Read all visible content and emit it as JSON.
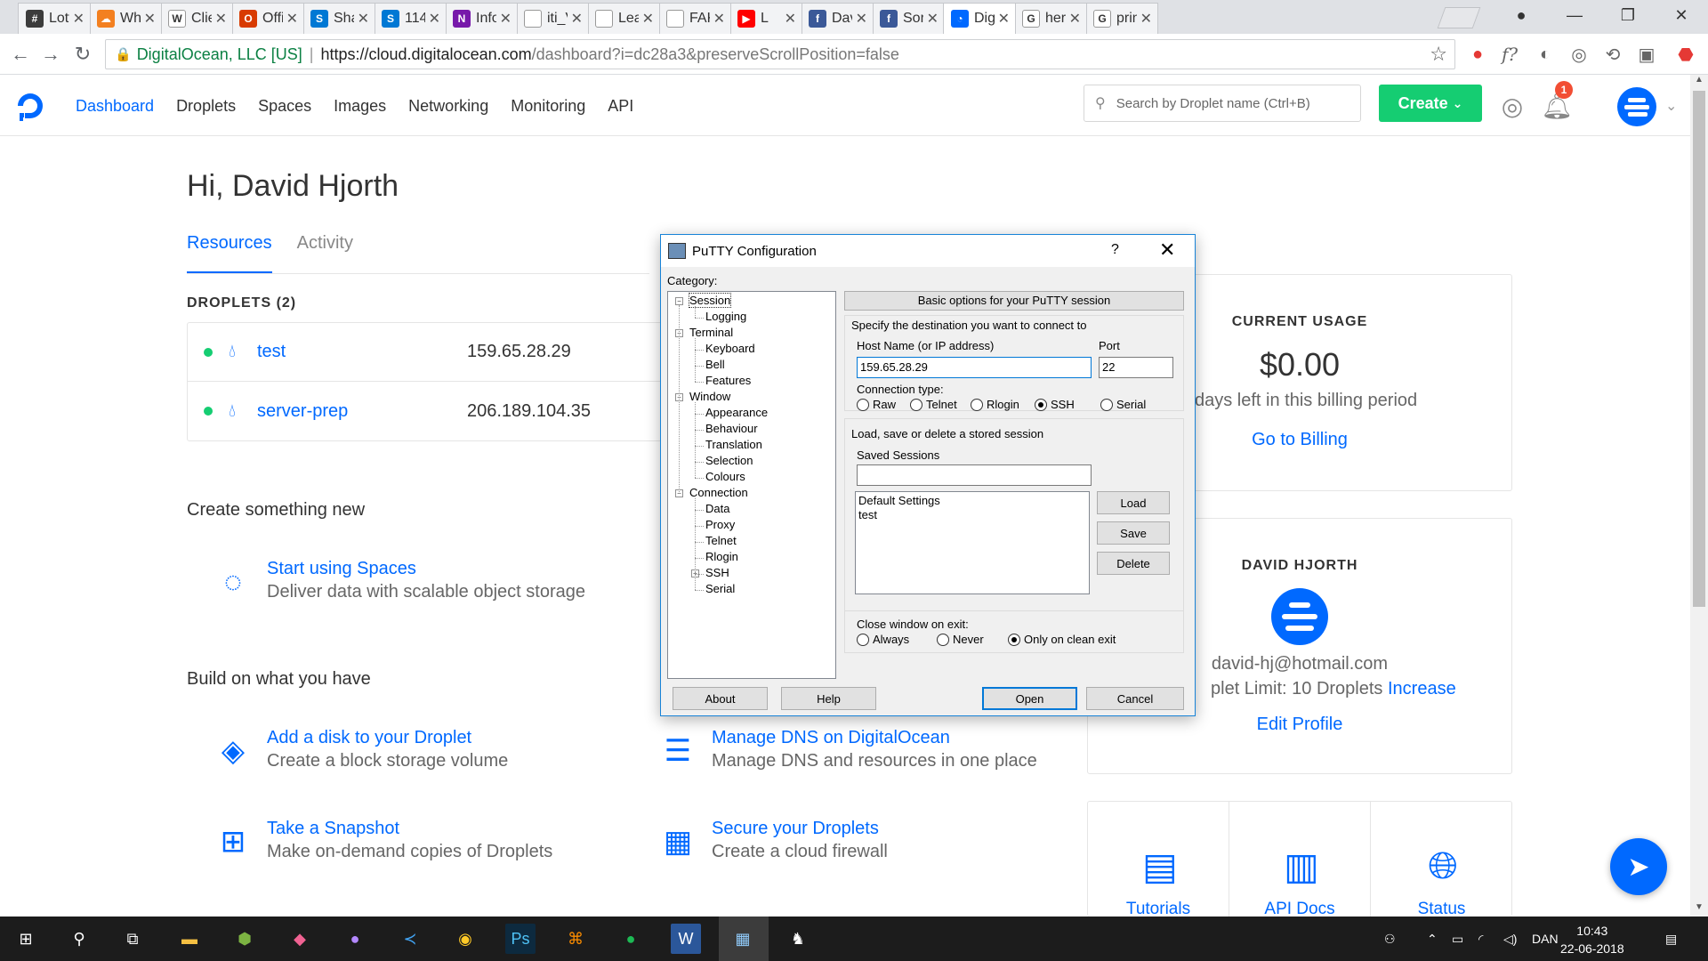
{
  "browser": {
    "tabs": [
      {
        "label": "Lott",
        "icon": "slack-icon",
        "color": "#3c3c3c",
        "glyph": "#"
      },
      {
        "label": "Wha",
        "icon": "cloudflare-icon",
        "color": "#f38020",
        "glyph": "☁"
      },
      {
        "label": "Clie",
        "icon": "wikipedia-icon",
        "color": "#ffffff",
        "glyph": "W"
      },
      {
        "label": "Offi",
        "icon": "office-icon",
        "color": "#d83b01",
        "glyph": "O"
      },
      {
        "label": "Sha",
        "icon": "sharepoint-icon",
        "color": "#0078d4",
        "glyph": "S"
      },
      {
        "label": "114",
        "icon": "sharepoint-icon",
        "color": "#0078d4",
        "glyph": "S"
      },
      {
        "label": "Info",
        "icon": "onenote-icon",
        "color": "#7719aa",
        "glyph": "N"
      },
      {
        "label": "iti_V",
        "icon": "document-icon",
        "color": "#ffffff",
        "glyph": ""
      },
      {
        "label": "Leav",
        "icon": "document-icon",
        "color": "#ffffff",
        "glyph": ""
      },
      {
        "label": "FAK",
        "icon": "document-icon",
        "color": "#ffffff",
        "glyph": ""
      },
      {
        "label": "L",
        "icon": "youtube-icon",
        "color": "#ff0000",
        "glyph": "▶"
      },
      {
        "label": "Dav",
        "icon": "facebook-icon",
        "color": "#3b5998",
        "glyph": "f"
      },
      {
        "label": "Sori",
        "icon": "facebook-icon",
        "color": "#3b5998",
        "glyph": "f"
      },
      {
        "label": "Digi",
        "icon": "digitalocean-icon",
        "color": "#0069ff",
        "glyph": "◔"
      },
      {
        "label": "hero",
        "icon": "google-icon",
        "color": "#ffffff",
        "glyph": "G"
      },
      {
        "label": "prin",
        "icon": "google-icon",
        "color": "#ffffff",
        "glyph": "G"
      }
    ],
    "address": {
      "org": "DigitalOcean, LLC [US]",
      "url_host": "https://cloud.digitalocean.com",
      "url_rest": "/dashboard?i=dc28a3&preserveScrollPosition=false"
    }
  },
  "nav": {
    "links": [
      "Dashboard",
      "Droplets",
      "Spaces",
      "Images",
      "Networking",
      "Monitoring",
      "API"
    ],
    "search_placeholder": "Search by Droplet name (Ctrl+B)",
    "create_label": "Create",
    "notification_count": "1"
  },
  "dashboard": {
    "greeting": "Hi, David Hjorth",
    "tabs": [
      "Resources",
      "Activity"
    ],
    "droplets_label": "DROPLETS (2)",
    "droplets": [
      {
        "name": "test",
        "ip": "159.65.28.29"
      },
      {
        "name": "server-prep",
        "ip": "206.189.104.35"
      }
    ],
    "create_heading": "Create something new",
    "create_items": [
      {
        "title": "Start using Spaces",
        "desc": "Deliver data with scalable object storage"
      }
    ],
    "build_heading": "Build on what you have",
    "build_items": [
      {
        "title": "Add a disk to your Droplet",
        "desc": "Create a block storage volume"
      },
      {
        "title": "Manage DNS on DigitalOcean",
        "desc": "Manage DNS and resources in one place"
      },
      {
        "title": "Take a Snapshot",
        "desc": "Make on-demand copies of Droplets"
      },
      {
        "title": "Secure your Droplets",
        "desc": "Create a cloud firewall"
      }
    ],
    "usage": {
      "title": "CURRENT USAGE",
      "amount": "$0.00",
      "days": "days left in this billing period",
      "link": "Go to Billing"
    },
    "profile": {
      "name": "DAVID HJORTH",
      "email": "david-hj@hotmail.com",
      "limit": "plet Limit: 10 Droplets",
      "increase": "Increase",
      "edit": "Edit Profile"
    },
    "resources": [
      "Tutorials",
      "API Docs",
      "Status"
    ]
  },
  "putty": {
    "title": "PuTTY Configuration",
    "help_mark": "?",
    "category_label": "Category:",
    "tree": [
      {
        "label": "Session",
        "level": 0,
        "expander": "−"
      },
      {
        "label": "Logging",
        "level": 1
      },
      {
        "label": "Terminal",
        "level": 0,
        "expander": "−"
      },
      {
        "label": "Keyboard",
        "level": 1
      },
      {
        "label": "Bell",
        "level": 1
      },
      {
        "label": "Features",
        "level": 1
      },
      {
        "label": "Window",
        "level": 0,
        "expander": "−"
      },
      {
        "label": "Appearance",
        "level": 1
      },
      {
        "label": "Behaviour",
        "level": 1
      },
      {
        "label": "Translation",
        "level": 1
      },
      {
        "label": "Selection",
        "level": 1
      },
      {
        "label": "Colours",
        "level": 1
      },
      {
        "label": "Connection",
        "level": 0,
        "expander": "−"
      },
      {
        "label": "Data",
        "level": 1
      },
      {
        "label": "Proxy",
        "level": 1
      },
      {
        "label": "Telnet",
        "level": 1
      },
      {
        "label": "Rlogin",
        "level": 1
      },
      {
        "label": "SSH",
        "level": 1,
        "expander": "+"
      },
      {
        "label": "Serial",
        "level": 1
      }
    ],
    "basic_header": "Basic options for your PuTTY session",
    "destination_label": "Specify the destination you want to connect to",
    "host_label": "Host Name (or IP address)",
    "host_value": "159.65.28.29",
    "port_label": "Port",
    "port_value": "22",
    "conn_type_label": "Connection type:",
    "conn_types": [
      {
        "label": "Raw",
        "checked": false
      },
      {
        "label": "Telnet",
        "checked": false
      },
      {
        "label": "Rlogin",
        "checked": false
      },
      {
        "label": "SSH",
        "checked": true
      },
      {
        "label": "Serial",
        "checked": false
      }
    ],
    "session_group_label": "Load, save or delete a stored session",
    "saved_sessions_label": "Saved Sessions",
    "saved_sessions_value": "",
    "sessions": [
      "Default Settings",
      "test"
    ],
    "load_label": "Load",
    "save_label": "Save",
    "delete_label": "Delete",
    "close_label": "Close window on exit:",
    "close_options": [
      {
        "label": "Always",
        "checked": false
      },
      {
        "label": "Never",
        "checked": false
      },
      {
        "label": "Only on clean exit",
        "checked": true
      }
    ],
    "about_label": "About",
    "help_label": "Help",
    "open_label": "Open",
    "cancel_label": "Cancel"
  },
  "taskbar": {
    "language": "DAN",
    "time": "10:43",
    "date": "22-06-2018"
  }
}
